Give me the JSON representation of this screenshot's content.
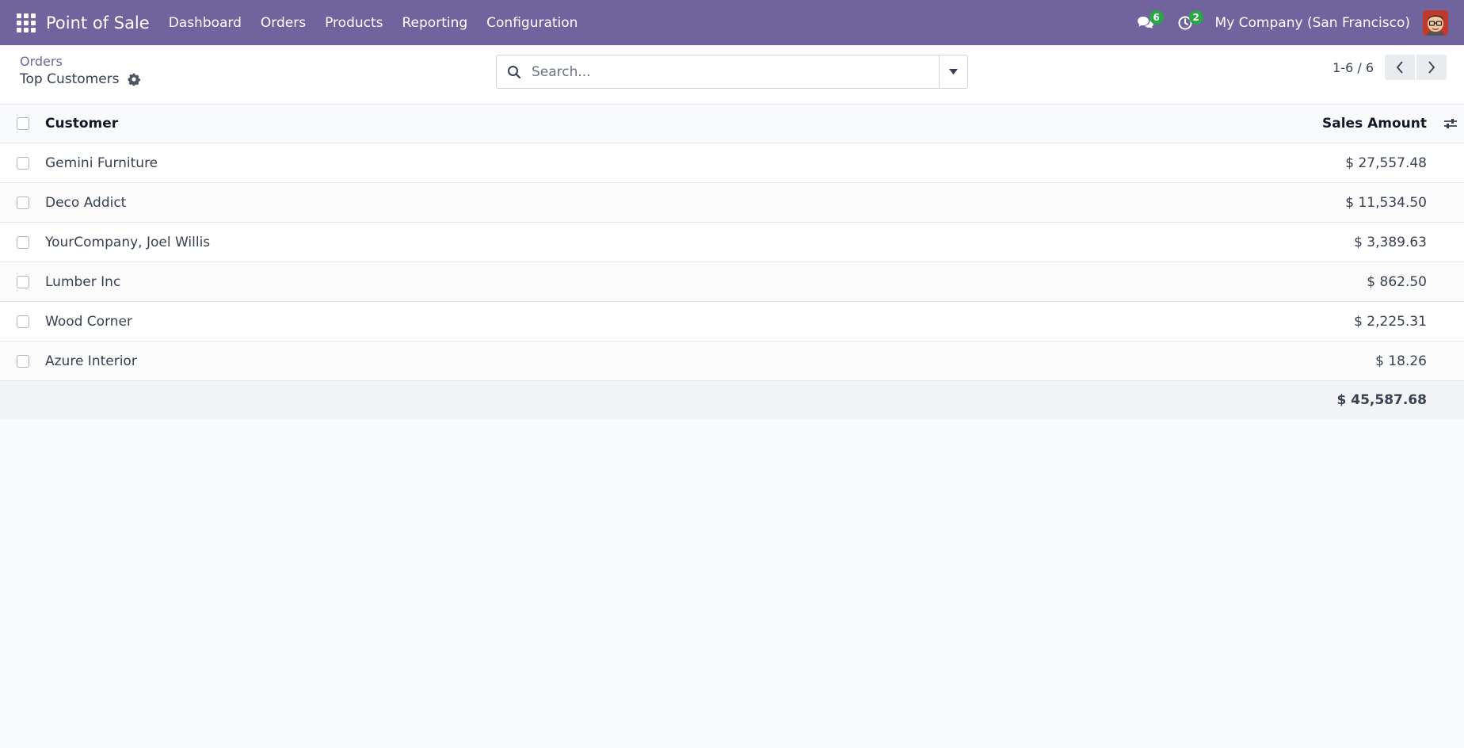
{
  "navbar": {
    "brand": "Point of Sale",
    "menu": [
      {
        "label": "Dashboard"
      },
      {
        "label": "Orders"
      },
      {
        "label": "Products"
      },
      {
        "label": "Reporting"
      },
      {
        "label": "Configuration"
      }
    ],
    "messages_count": "6",
    "activities_count": "2",
    "company": "My Company (San Francisco)"
  },
  "control_panel": {
    "breadcrumb_parent": "Orders",
    "breadcrumb_current": "Top Customers",
    "search_placeholder": "Search...",
    "pager": "1-6 / 6"
  },
  "table": {
    "columns": {
      "customer": "Customer",
      "sales_amount": "Sales Amount"
    },
    "rows": [
      {
        "customer": "Gemini Furniture",
        "amount": "$ 27,557.48"
      },
      {
        "customer": "Deco Addict",
        "amount": "$ 11,534.50"
      },
      {
        "customer": "YourCompany, Joel Willis",
        "amount": "$ 3,389.63"
      },
      {
        "customer": "Lumber Inc",
        "amount": "$ 862.50"
      },
      {
        "customer": "Wood Corner",
        "amount": "$ 2,225.31"
      },
      {
        "customer": "Azure Interior",
        "amount": "$ 18.26"
      }
    ],
    "total": "$ 45,587.68"
  },
  "colors": {
    "brand": "#71639e",
    "badge": "#28a745"
  }
}
